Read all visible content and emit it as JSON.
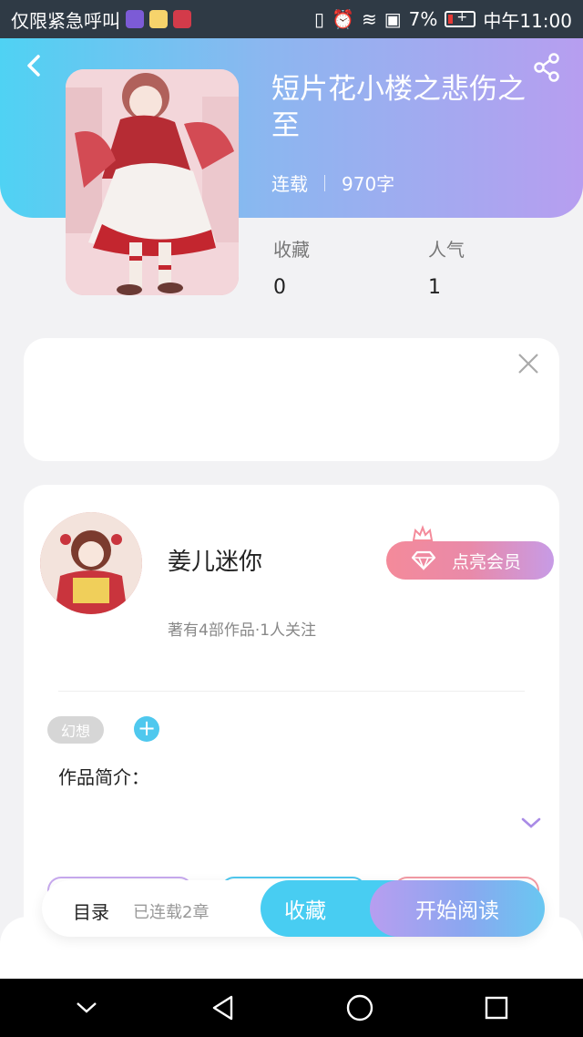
{
  "status_bar": {
    "carrier": "仅限紧急呼叫",
    "battery": "7%",
    "time": "中午11:00"
  },
  "book": {
    "title": "短片花小楼之悲伤之至",
    "status": "连载",
    "word_count": "970字"
  },
  "stats": [
    {
      "label": "收藏",
      "value": "0"
    },
    {
      "label": "人气",
      "value": "1"
    }
  ],
  "author": {
    "name": "姜儿迷你",
    "summary": "著有4部作品·1人关注",
    "vip_label": "点亮会员"
  },
  "tags": [
    {
      "label": "幻想"
    }
  ],
  "intro_label": "作品简介：",
  "bottom_bar": {
    "toc_label": "目录",
    "toc_sub": "已连载2章",
    "favorite_label": "收藏",
    "read_label": "开始阅读"
  },
  "colors": {
    "header_gradient_start": "#4fd2f3",
    "header_gradient_end": "#b79ef0",
    "accent_blue": "#48cdf2",
    "vip_pink": "#f48a9a"
  },
  "icons": {
    "back": "chevron-left-icon",
    "share": "share-icon",
    "close": "close-icon",
    "gem": "diamond-icon",
    "crown": "crown-icon",
    "expand": "chevron-down-icon",
    "nav_hide": "chevron-down-icon",
    "nav_back": "triangle-back-icon",
    "nav_home": "circle-home-icon",
    "nav_recents": "square-recents-icon"
  }
}
